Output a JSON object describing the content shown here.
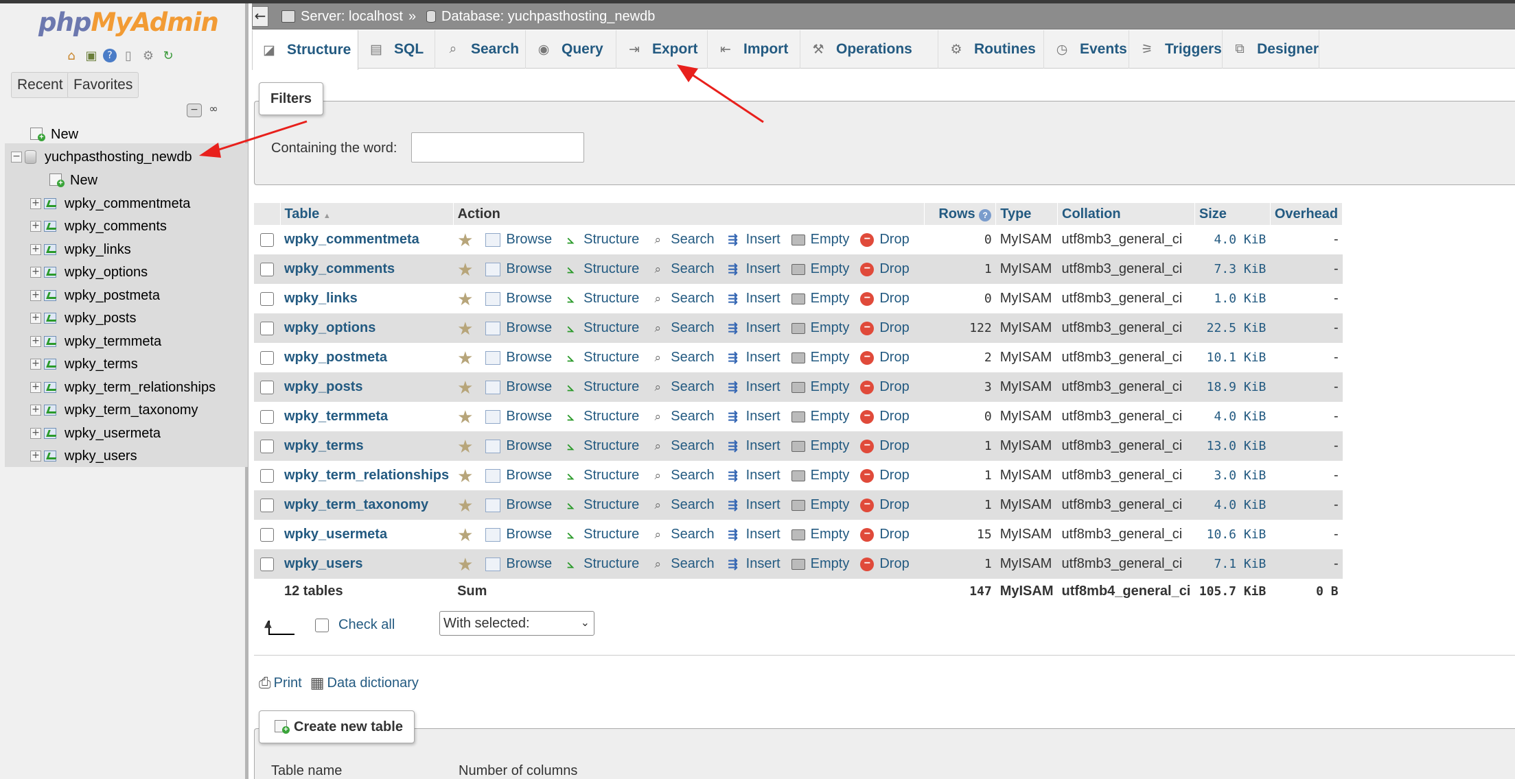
{
  "sidebar": {
    "logo_php": "php",
    "logo_admin": "MyAdmin",
    "tabs": {
      "recent": "Recent",
      "favorites": "Favorites"
    },
    "tree_new": "New",
    "database": "yuchpasthosting_newdb",
    "db_new": "New",
    "tables": [
      "wpky_commentmeta",
      "wpky_comments",
      "wpky_links",
      "wpky_options",
      "wpky_postmeta",
      "wpky_posts",
      "wpky_termmeta",
      "wpky_terms",
      "wpky_term_relationships",
      "wpky_term_taxonomy",
      "wpky_usermeta",
      "wpky_users"
    ]
  },
  "breadcrumb": {
    "server": "Server: localhost",
    "separator": "»",
    "database": "Database: yuchpasthosting_newdb"
  },
  "tabs": [
    {
      "label": "Structure",
      "icon": "structure-icon"
    },
    {
      "label": "SQL",
      "icon": "sql-icon"
    },
    {
      "label": "Search",
      "icon": "search-icon"
    },
    {
      "label": "Query",
      "icon": "query-icon"
    },
    {
      "label": "Export",
      "icon": "export-icon"
    },
    {
      "label": "Import",
      "icon": "import-icon"
    },
    {
      "label": "Operations",
      "icon": "wrench-icon"
    },
    {
      "label": "Routines",
      "icon": "routines-icon"
    },
    {
      "label": "Events",
      "icon": "clock-icon"
    },
    {
      "label": "Triggers",
      "icon": "triggers-icon"
    },
    {
      "label": "Designer",
      "icon": "designer-icon"
    }
  ],
  "filters": {
    "legend": "Filters",
    "label": "Containing the word:",
    "value": ""
  },
  "table": {
    "headers": {
      "table": "Table",
      "sort_indicator": "▲",
      "action": "Action",
      "rows": "Rows",
      "type": "Type",
      "collation": "Collation",
      "size": "Size",
      "overhead": "Overhead"
    },
    "actions": {
      "browse": "Browse",
      "structure": "Structure",
      "search": "Search",
      "insert": "Insert",
      "empty": "Empty",
      "drop": "Drop"
    },
    "rows": [
      {
        "name": "wpky_commentmeta",
        "rows": "0",
        "type": "MyISAM",
        "collation": "utf8mb3_general_ci",
        "size": "4.0 KiB",
        "overhead": "-"
      },
      {
        "name": "wpky_comments",
        "rows": "1",
        "type": "MyISAM",
        "collation": "utf8mb3_general_ci",
        "size": "7.3 KiB",
        "overhead": "-"
      },
      {
        "name": "wpky_links",
        "rows": "0",
        "type": "MyISAM",
        "collation": "utf8mb3_general_ci",
        "size": "1.0 KiB",
        "overhead": "-"
      },
      {
        "name": "wpky_options",
        "rows": "122",
        "type": "MyISAM",
        "collation": "utf8mb3_general_ci",
        "size": "22.5 KiB",
        "overhead": "-"
      },
      {
        "name": "wpky_postmeta",
        "rows": "2",
        "type": "MyISAM",
        "collation": "utf8mb3_general_ci",
        "size": "10.1 KiB",
        "overhead": "-"
      },
      {
        "name": "wpky_posts",
        "rows": "3",
        "type": "MyISAM",
        "collation": "utf8mb3_general_ci",
        "size": "18.9 KiB",
        "overhead": "-"
      },
      {
        "name": "wpky_termmeta",
        "rows": "0",
        "type": "MyISAM",
        "collation": "utf8mb3_general_ci",
        "size": "4.0 KiB",
        "overhead": "-"
      },
      {
        "name": "wpky_terms",
        "rows": "1",
        "type": "MyISAM",
        "collation": "utf8mb3_general_ci",
        "size": "13.0 KiB",
        "overhead": "-"
      },
      {
        "name": "wpky_term_relationships",
        "rows": "1",
        "type": "MyISAM",
        "collation": "utf8mb3_general_ci",
        "size": "3.0 KiB",
        "overhead": "-"
      },
      {
        "name": "wpky_term_taxonomy",
        "rows": "1",
        "type": "MyISAM",
        "collation": "utf8mb3_general_ci",
        "size": "4.0 KiB",
        "overhead": "-"
      },
      {
        "name": "wpky_usermeta",
        "rows": "15",
        "type": "MyISAM",
        "collation": "utf8mb3_general_ci",
        "size": "10.6 KiB",
        "overhead": "-"
      },
      {
        "name": "wpky_users",
        "rows": "1",
        "type": "MyISAM",
        "collation": "utf8mb3_general_ci",
        "size": "7.1 KiB",
        "overhead": "-"
      }
    ],
    "footer": {
      "count": "12 tables",
      "sum": "Sum",
      "rows": "147",
      "type": "MyISAM",
      "collation": "utf8mb4_general_ci",
      "size": "105.7 KiB",
      "overhead": "0 B"
    }
  },
  "bulk": {
    "check_all": "Check all",
    "with_selected": "With selected:"
  },
  "links": {
    "print": "Print",
    "data_dictionary": "Data dictionary"
  },
  "create_table": {
    "legend": "Create new table",
    "table_name_label": "Table name",
    "num_columns_label": "Number of columns"
  },
  "colors": {
    "link": "#235a81",
    "annotation_arrow": "#e8201c"
  }
}
